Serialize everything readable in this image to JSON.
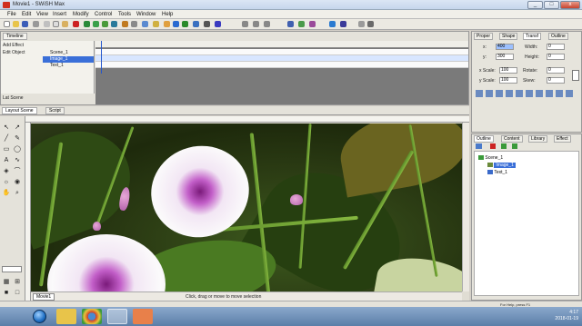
{
  "window": {
    "title": "Movie1 - SWiSH Max",
    "min": "_",
    "max": "□",
    "close": "x"
  },
  "menu": [
    "File",
    "Edit",
    "View",
    "Insert",
    "Modify",
    "Control",
    "Tools",
    "Window",
    "Help"
  ],
  "timeline": {
    "tab": "Timeline",
    "left_items": [
      "Add Effect",
      "Edit Object",
      "Lat Scene"
    ],
    "layers": [
      "Scene_1",
      "Image_1",
      "Text_1"
    ],
    "selected_layer": 1
  },
  "properties": {
    "tabs": [
      "Proper",
      "Shape",
      "Transf",
      "Outline"
    ],
    "active_tab": 2,
    "fields": {
      "x_label": "x:",
      "x_value": "400",
      "y_label": "y:",
      "y_value": "300",
      "width_label": "Width:",
      "width_value": "0",
      "height_label": "Height:",
      "height_value": "0",
      "x_scale_label": "x Scale:",
      "x_scale_value": "100",
      "y_scale_label": "y Scale:",
      "y_scale_value": "100",
      "rotate_label": "Rotate:",
      "rotate_value": "0",
      "skew_label": "Skew:",
      "skew_value": "0"
    }
  },
  "stage": {
    "tabs": [
      "Layout Scene",
      "Script"
    ],
    "active_tab": 0,
    "movie_tab": "Movie1",
    "status_text": "Click, drag or move to move selection"
  },
  "library": {
    "tabs": [
      "Outline",
      "Content",
      "Library",
      "Effect"
    ],
    "active_tab": 0,
    "tree": [
      {
        "label": "Scene_1",
        "indent": 0,
        "selected": false
      },
      {
        "label": "Image_1",
        "indent": 1,
        "selected": true
      },
      {
        "label": "Text_1",
        "indent": 1,
        "selected": false
      }
    ]
  },
  "statusbar": {
    "text": "For Help, press F1"
  },
  "taskbar": {
    "time": "4:17",
    "date": "2018-01-19"
  },
  "colors": {
    "accent": "#3a6fd8",
    "panel": "#e4e2da"
  }
}
